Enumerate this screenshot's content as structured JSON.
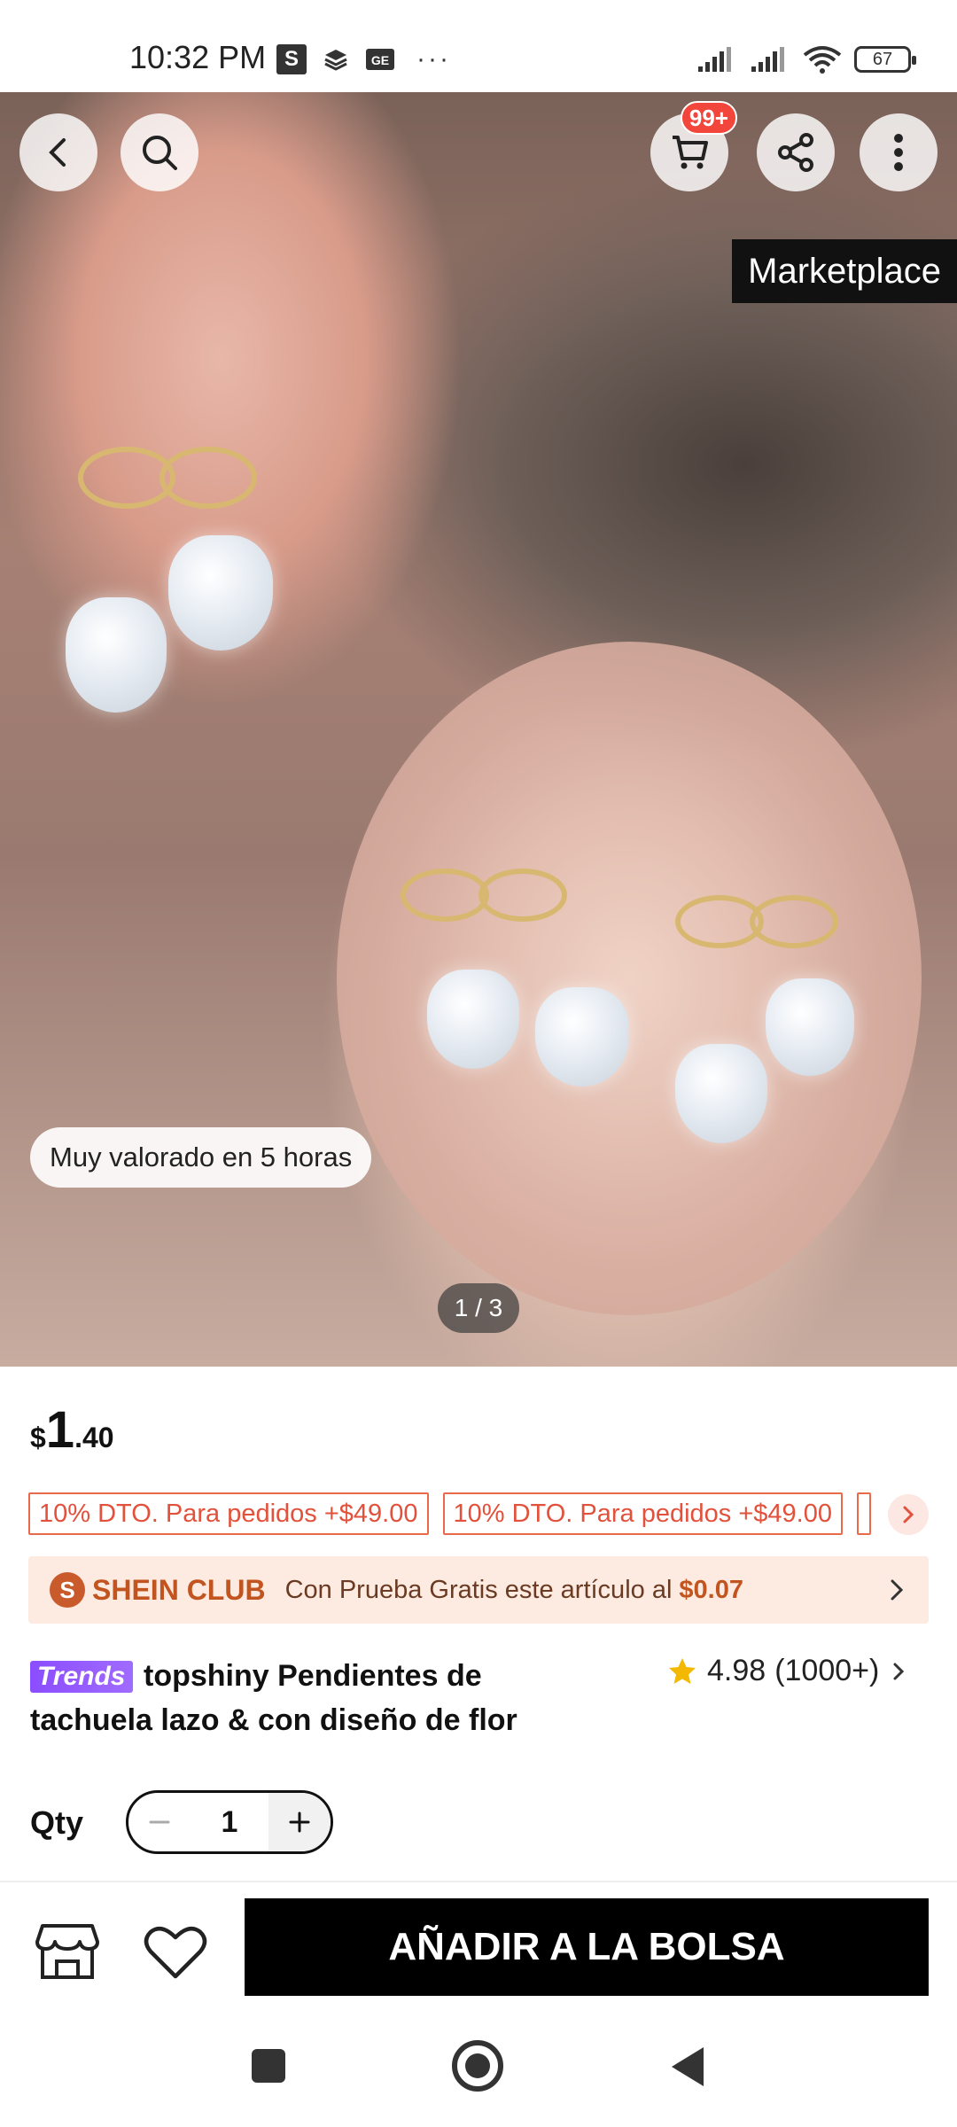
{
  "status_bar": {
    "time": "10:32 PM",
    "left_icons": [
      "s-app-icon",
      "layers-icon",
      "ge-icon"
    ],
    "more": "···",
    "battery": "67"
  },
  "hero": {
    "cart_badge": "99+",
    "marketplace_tag": "Marketplace",
    "rating_chip": "Muy valorado en 5 horas",
    "pager": "1 / 3"
  },
  "price": {
    "currency": "$",
    "integer": "1",
    "decimal": ".40"
  },
  "coupons": [
    "10% DTO. Para pedidos +$49.00",
    "10% DTO. Para pedidos +$49.00"
  ],
  "club": {
    "logo_letter": "S",
    "name": "SHEIN CLUB",
    "text": "Con Prueba Gratis este artículo al",
    "amount": "$0.07"
  },
  "product": {
    "badge": "Trends",
    "title_line1": "topshiny Pendientes de",
    "title_line2": "tachuela lazo & con diseño de flor",
    "rating": "4.98",
    "rating_count": "(1000+)"
  },
  "qty": {
    "label": "Qty",
    "value": "1"
  },
  "bottom": {
    "add_to_bag": "AÑADIR A LA BOLSA"
  },
  "colors": {
    "accent": "#e2513b",
    "club_bg": "#fdebe2",
    "cta": "#000000"
  }
}
